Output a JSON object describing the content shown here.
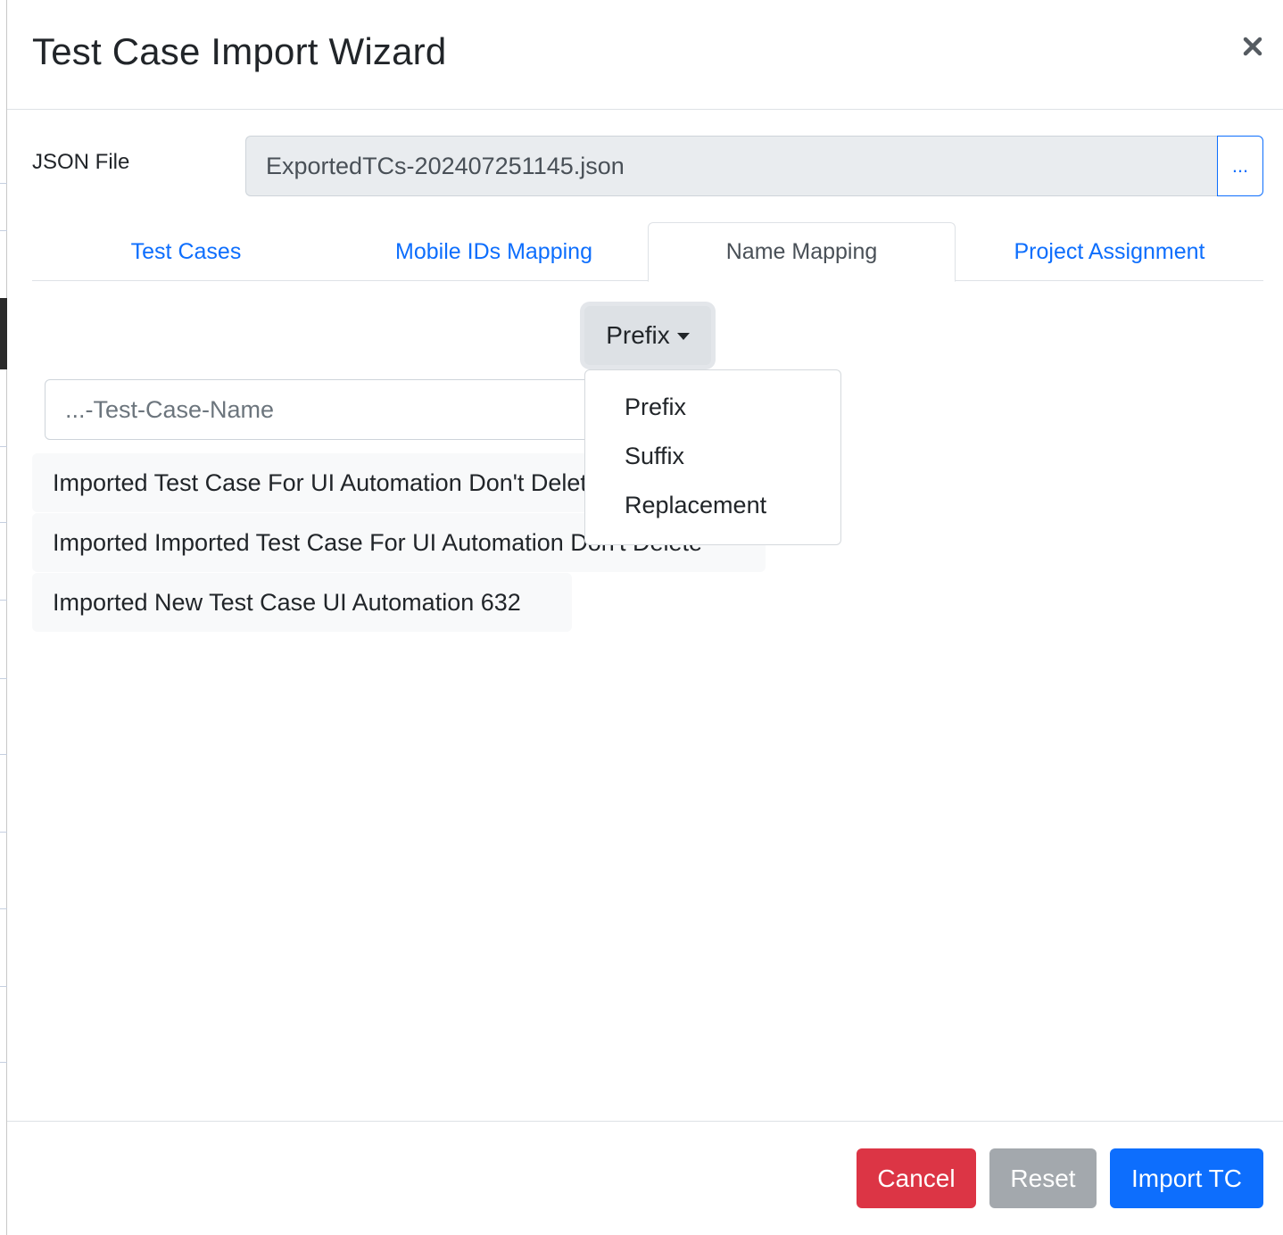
{
  "modal": {
    "title": "Test Case Import Wizard"
  },
  "file": {
    "label": "JSON File",
    "value": "ExportedTCs-202407251145.json",
    "browse_label": "..."
  },
  "tabs": [
    {
      "label": "Test Cases",
      "active": false
    },
    {
      "label": "Mobile IDs Mapping",
      "active": false
    },
    {
      "label": "Name Mapping",
      "active": true
    },
    {
      "label": "Project Assignment",
      "active": false
    }
  ],
  "name_mapping": {
    "mode_selected": "Prefix",
    "input_placeholder": "...-Test-Case-Name",
    "mode_options": [
      "Prefix",
      "Suffix",
      "Replacement"
    ],
    "test_cases": [
      "Imported Test Case For UI Automation Don't Delete",
      "Imported Imported Test Case For UI Automation Don't Delete",
      "Imported New Test Case UI Automation 632"
    ]
  },
  "footer": {
    "cancel_label": "Cancel",
    "reset_label": "Reset",
    "import_label": "Import TC"
  },
  "colors": {
    "primary": "#0d6efd",
    "danger": "#dc3545",
    "secondary": "#a3a8ad"
  }
}
